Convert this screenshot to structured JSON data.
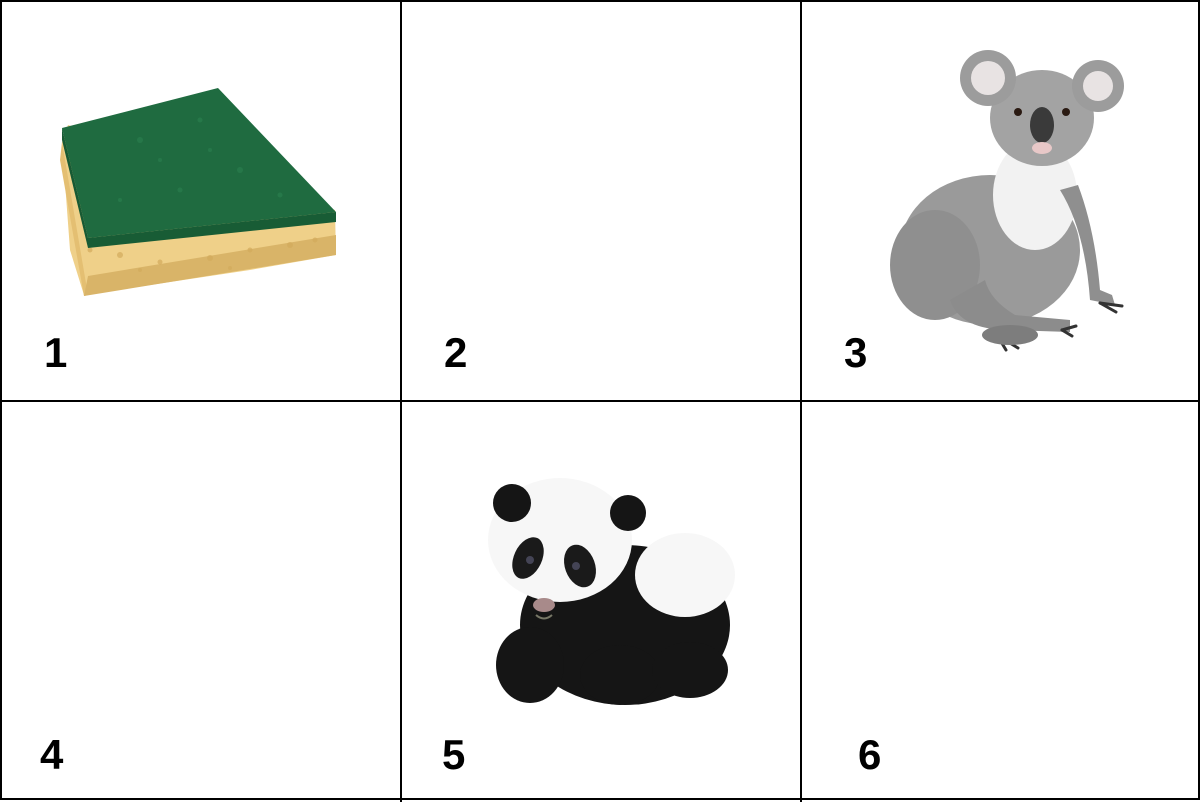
{
  "cells": [
    {
      "number": "1",
      "image": "sponge",
      "visible": true
    },
    {
      "number": "2",
      "image": "",
      "visible": false
    },
    {
      "number": "3",
      "image": "koala",
      "visible": true
    },
    {
      "number": "4",
      "image": "",
      "visible": false
    },
    {
      "number": "5",
      "image": "panda",
      "visible": true
    },
    {
      "number": "6",
      "image": "",
      "visible": false
    }
  ],
  "colors": {
    "border": "#000000",
    "sponge_scrub": "#1f6b40",
    "sponge_foam": "#f0d48c",
    "koala_fur": "#9a9a9a",
    "koala_chest": "#f2f2f2",
    "panda_black": "#151515",
    "panda_white": "#f7f7f7"
  }
}
